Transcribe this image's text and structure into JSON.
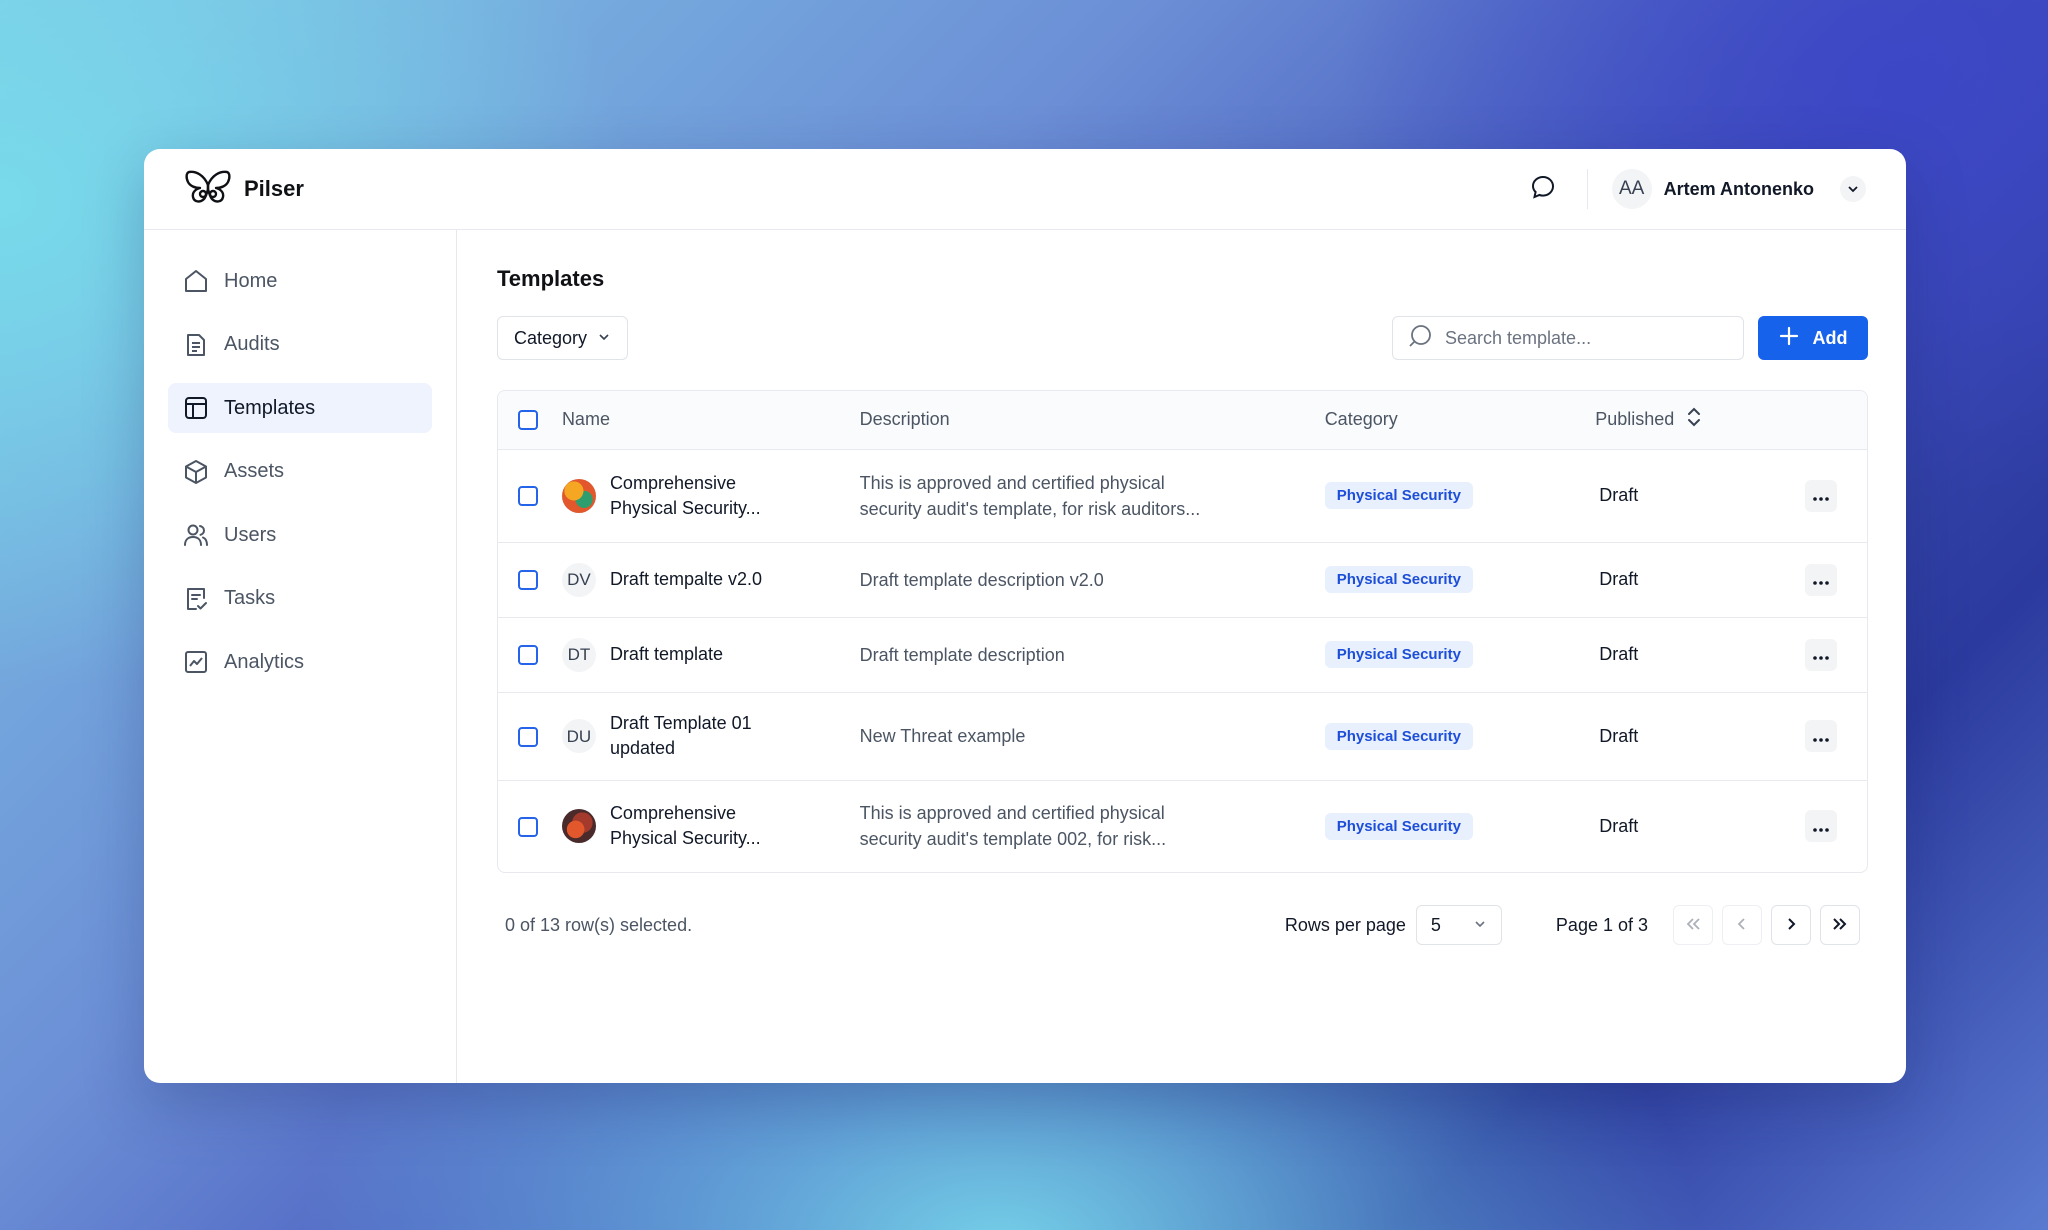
{
  "app": {
    "name": "Pilser"
  },
  "user": {
    "initials": "AA",
    "name": "Artem Antonenko"
  },
  "sidebar": {
    "items": [
      {
        "label": "Home",
        "icon": "home-icon"
      },
      {
        "label": "Audits",
        "icon": "document-icon"
      },
      {
        "label": "Templates",
        "icon": "layout-icon",
        "active": true
      },
      {
        "label": "Assets",
        "icon": "cube-icon"
      },
      {
        "label": "Users",
        "icon": "users-icon"
      },
      {
        "label": "Tasks",
        "icon": "checklist-icon"
      },
      {
        "label": "Analytics",
        "icon": "chart-icon"
      }
    ]
  },
  "main": {
    "title": "Templates",
    "filter_label": "Category",
    "search_placeholder": "Search template...",
    "add_label": "Add"
  },
  "table": {
    "headers": {
      "name": "Name",
      "description": "Description",
      "category": "Category",
      "published": "Published"
    },
    "rows": [
      {
        "avatar": "image",
        "initials": "",
        "name_line1": "Comprehensive",
        "name_line2": "Physical Security...",
        "desc_line1": "This is approved and certified physical",
        "desc_line2": "security audit's template, for risk auditors...",
        "category": "Physical Security",
        "published": "Draft"
      },
      {
        "avatar": "initials",
        "initials": "DV",
        "name_line1": "Draft tempalte v2.0",
        "name_line2": "",
        "desc_line1": "Draft template description v2.0",
        "desc_line2": "",
        "category": "Physical Security",
        "published": "Draft"
      },
      {
        "avatar": "initials",
        "initials": "DT",
        "name_line1": "Draft template",
        "name_line2": "",
        "desc_line1": "Draft template description",
        "desc_line2": "",
        "category": "Physical Security",
        "published": "Draft"
      },
      {
        "avatar": "initials",
        "initials": "DU",
        "name_line1": "Draft Template 01",
        "name_line2": "updated",
        "desc_line1": "New Threat example",
        "desc_line2": "",
        "category": "Physical Security",
        "published": "Draft"
      },
      {
        "avatar": "image",
        "initials": "",
        "name_line1": "Comprehensive",
        "name_line2": "Physical Security...",
        "desc_line1": "This is approved and certified physical",
        "desc_line2": "security audit's template 002, for risk...",
        "category": "Physical Security",
        "published": "Draft"
      }
    ]
  },
  "footer": {
    "selected_text": "0 of 13 row(s) selected.",
    "rows_per_page_label": "Rows per page",
    "rows_per_page_value": "5",
    "page_text": "Page 1 of 3"
  },
  "colors": {
    "accent": "#1762ea",
    "badge_bg": "#e8f0fd",
    "badge_text": "#1d4ed8",
    "active_nav_bg": "#eef3fd"
  }
}
